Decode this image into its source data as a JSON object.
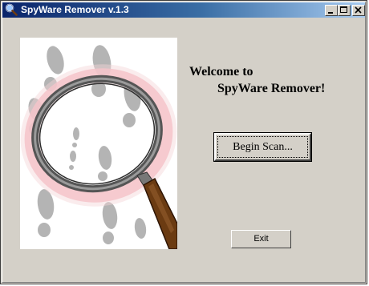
{
  "window": {
    "title": "SpyWare Remover v.1.3",
    "app_icon": "magnifier-icon",
    "controls": [
      "minimize-icon",
      "maximize-icon",
      "close-icon"
    ]
  },
  "welcome": {
    "line1": "Welcome to",
    "line2": "SpyWare Remover!"
  },
  "buttons": {
    "begin_scan": "Begin Scan...",
    "exit": "Exit"
  },
  "illustration": "magnifying-glass-over-footprints"
}
